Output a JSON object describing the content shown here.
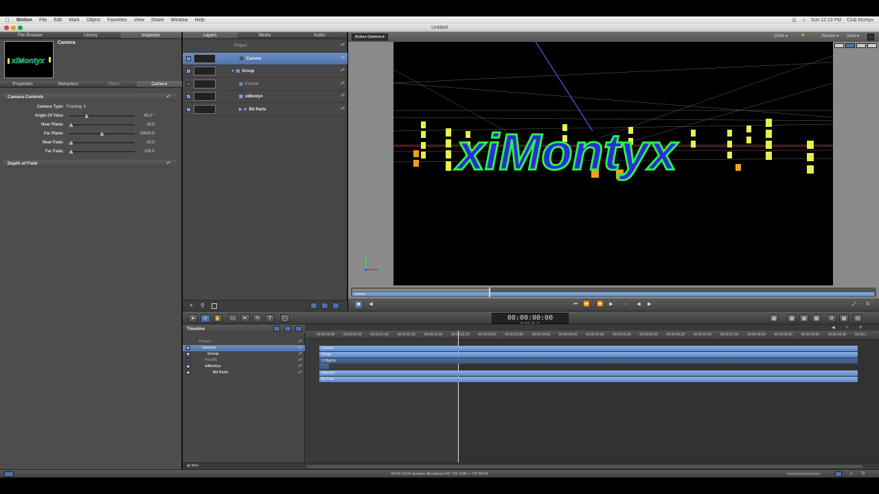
{
  "menubar": {
    "app_name": "Motion",
    "items": [
      "File",
      "Edit",
      "Mark",
      "Object",
      "Favorites",
      "View",
      "Share",
      "Window",
      "Help"
    ],
    "clock": "Sun 12:13 PM",
    "user": "Club Montyx"
  },
  "window": {
    "title": "Untitled"
  },
  "left_panel": {
    "tabs": [
      "File Browser",
      "Library",
      "Inspector"
    ],
    "active_tab": "Inspector",
    "preview_title": "Camera",
    "sub_tabs": [
      "Properties",
      "Behaviors",
      "Filters",
      "Camera"
    ],
    "camera_controls": {
      "title": "Camera Controls",
      "camera_type_label": "Camera Type:",
      "camera_type_value": "Framing",
      "params": [
        {
          "label": "Angle Of View:",
          "value": "45.0 °",
          "knob": 0.25
        },
        {
          "label": "Near Plane:",
          "value": "10.0",
          "knob": 0.0
        },
        {
          "label": "Far Plane:",
          "value": "10000.0",
          "knob": 0.5
        },
        {
          "label": "Near Fade:",
          "value": "10.0",
          "knob": 0.0
        },
        {
          "label": "Far Fade:",
          "value": "100.0",
          "knob": 0.0
        }
      ]
    },
    "depth_of_field": "Depth of Field"
  },
  "layers_panel": {
    "tabs": [
      "Layers",
      "Media",
      "Audio"
    ],
    "active_tab": "Layers",
    "rows": [
      {
        "name": "Project",
        "checked": false,
        "selected": false
      },
      {
        "name": "Camera",
        "checked": true,
        "selected": true
      },
      {
        "name": "Group",
        "checked": true,
        "selected": false
      },
      {
        "name": "Pixel06",
        "checked": false,
        "selected": false
      },
      {
        "name": "xiMontyx",
        "checked": true,
        "selected": false
      },
      {
        "name": "Bit Parts",
        "checked": true,
        "selected": false
      }
    ]
  },
  "canvas": {
    "view_label": "Active Camera",
    "zoom": "100%",
    "render_label": "Render",
    "view_menu": "View",
    "mini_timeline_label": "Camera",
    "logo_text": "xiMontyx"
  },
  "toolbar": {
    "timecode": "00:00:00:00",
    "timecode_sub": "HR  MIN  SEC  FR"
  },
  "timeline": {
    "title": "Timeline",
    "rows": [
      {
        "name": "Project",
        "selected": false
      },
      {
        "name": "Camera",
        "selected": true
      },
      {
        "name": "Group",
        "selected": false
      },
      {
        "name": "Pixel06",
        "selected": false
      },
      {
        "name": "xiMontyx",
        "selected": false
      },
      {
        "name": "Bit Parts",
        "selected": false
      }
    ],
    "ruler_ticks": [
      "00:00:00;00",
      "00:00:00;30",
      "00:00:01;00",
      "00:00:01;30",
      "00:00:02;00",
      "00:00:02;30",
      "00:00:03;00",
      "00:00:03;30",
      "00:00:04;00",
      "00:00:04;30",
      "00:00:05;00",
      "00:00:05;30",
      "00:00:06;00",
      "00:00:06;30",
      "00:00:07;00",
      "00:00:07;30",
      "00:00:08;00",
      "00:00:08;30",
      "00:00:09;00",
      "00:00:09;30",
      "00:00:1"
    ],
    "bars": [
      "Camera",
      "Group",
      "3 Objects",
      "",
      "xiMontyx",
      "Bit Parts"
    ],
    "footer_label": "Mini"
  },
  "status": {
    "text": "00:00:10;00 duration Broadcast HD 720 1280 x 720 59.94"
  },
  "colors": {
    "accent": "#5a86c6",
    "logo_fill": "#2a2cd8",
    "logo_stroke": "#2ef04a",
    "bar_yellow": "#e6f24a",
    "bar_orange": "#f0a020"
  }
}
